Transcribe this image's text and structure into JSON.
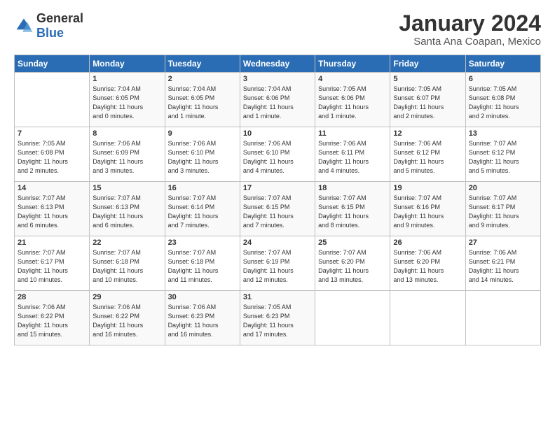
{
  "header": {
    "logo_general": "General",
    "logo_blue": "Blue",
    "title": "January 2024",
    "subtitle": "Santa Ana Coapan, Mexico"
  },
  "calendar": {
    "days_of_week": [
      "Sunday",
      "Monday",
      "Tuesday",
      "Wednesday",
      "Thursday",
      "Friday",
      "Saturday"
    ],
    "weeks": [
      [
        {
          "day": "",
          "info": ""
        },
        {
          "day": "1",
          "info": "Sunrise: 7:04 AM\nSunset: 6:05 PM\nDaylight: 11 hours\nand 0 minutes."
        },
        {
          "day": "2",
          "info": "Sunrise: 7:04 AM\nSunset: 6:05 PM\nDaylight: 11 hours\nand 1 minute."
        },
        {
          "day": "3",
          "info": "Sunrise: 7:04 AM\nSunset: 6:06 PM\nDaylight: 11 hours\nand 1 minute."
        },
        {
          "day": "4",
          "info": "Sunrise: 7:05 AM\nSunset: 6:06 PM\nDaylight: 11 hours\nand 1 minute."
        },
        {
          "day": "5",
          "info": "Sunrise: 7:05 AM\nSunset: 6:07 PM\nDaylight: 11 hours\nand 2 minutes."
        },
        {
          "day": "6",
          "info": "Sunrise: 7:05 AM\nSunset: 6:08 PM\nDaylight: 11 hours\nand 2 minutes."
        }
      ],
      [
        {
          "day": "7",
          "info": "Sunrise: 7:05 AM\nSunset: 6:08 PM\nDaylight: 11 hours\nand 2 minutes."
        },
        {
          "day": "8",
          "info": "Sunrise: 7:06 AM\nSunset: 6:09 PM\nDaylight: 11 hours\nand 3 minutes."
        },
        {
          "day": "9",
          "info": "Sunrise: 7:06 AM\nSunset: 6:10 PM\nDaylight: 11 hours\nand 3 minutes."
        },
        {
          "day": "10",
          "info": "Sunrise: 7:06 AM\nSunset: 6:10 PM\nDaylight: 11 hours\nand 4 minutes."
        },
        {
          "day": "11",
          "info": "Sunrise: 7:06 AM\nSunset: 6:11 PM\nDaylight: 11 hours\nand 4 minutes."
        },
        {
          "day": "12",
          "info": "Sunrise: 7:06 AM\nSunset: 6:12 PM\nDaylight: 11 hours\nand 5 minutes."
        },
        {
          "day": "13",
          "info": "Sunrise: 7:07 AM\nSunset: 6:12 PM\nDaylight: 11 hours\nand 5 minutes."
        }
      ],
      [
        {
          "day": "14",
          "info": "Sunrise: 7:07 AM\nSunset: 6:13 PM\nDaylight: 11 hours\nand 6 minutes."
        },
        {
          "day": "15",
          "info": "Sunrise: 7:07 AM\nSunset: 6:13 PM\nDaylight: 11 hours\nand 6 minutes."
        },
        {
          "day": "16",
          "info": "Sunrise: 7:07 AM\nSunset: 6:14 PM\nDaylight: 11 hours\nand 7 minutes."
        },
        {
          "day": "17",
          "info": "Sunrise: 7:07 AM\nSunset: 6:15 PM\nDaylight: 11 hours\nand 7 minutes."
        },
        {
          "day": "18",
          "info": "Sunrise: 7:07 AM\nSunset: 6:15 PM\nDaylight: 11 hours\nand 8 minutes."
        },
        {
          "day": "19",
          "info": "Sunrise: 7:07 AM\nSunset: 6:16 PM\nDaylight: 11 hours\nand 9 minutes."
        },
        {
          "day": "20",
          "info": "Sunrise: 7:07 AM\nSunset: 6:17 PM\nDaylight: 11 hours\nand 9 minutes."
        }
      ],
      [
        {
          "day": "21",
          "info": "Sunrise: 7:07 AM\nSunset: 6:17 PM\nDaylight: 11 hours\nand 10 minutes."
        },
        {
          "day": "22",
          "info": "Sunrise: 7:07 AM\nSunset: 6:18 PM\nDaylight: 11 hours\nand 10 minutes."
        },
        {
          "day": "23",
          "info": "Sunrise: 7:07 AM\nSunset: 6:18 PM\nDaylight: 11 hours\nand 11 minutes."
        },
        {
          "day": "24",
          "info": "Sunrise: 7:07 AM\nSunset: 6:19 PM\nDaylight: 11 hours\nand 12 minutes."
        },
        {
          "day": "25",
          "info": "Sunrise: 7:07 AM\nSunset: 6:20 PM\nDaylight: 11 hours\nand 13 minutes."
        },
        {
          "day": "26",
          "info": "Sunrise: 7:06 AM\nSunset: 6:20 PM\nDaylight: 11 hours\nand 13 minutes."
        },
        {
          "day": "27",
          "info": "Sunrise: 7:06 AM\nSunset: 6:21 PM\nDaylight: 11 hours\nand 14 minutes."
        }
      ],
      [
        {
          "day": "28",
          "info": "Sunrise: 7:06 AM\nSunset: 6:22 PM\nDaylight: 11 hours\nand 15 minutes."
        },
        {
          "day": "29",
          "info": "Sunrise: 7:06 AM\nSunset: 6:22 PM\nDaylight: 11 hours\nand 16 minutes."
        },
        {
          "day": "30",
          "info": "Sunrise: 7:06 AM\nSunset: 6:23 PM\nDaylight: 11 hours\nand 16 minutes."
        },
        {
          "day": "31",
          "info": "Sunrise: 7:05 AM\nSunset: 6:23 PM\nDaylight: 11 hours\nand 17 minutes."
        },
        {
          "day": "",
          "info": ""
        },
        {
          "day": "",
          "info": ""
        },
        {
          "day": "",
          "info": ""
        }
      ]
    ]
  }
}
